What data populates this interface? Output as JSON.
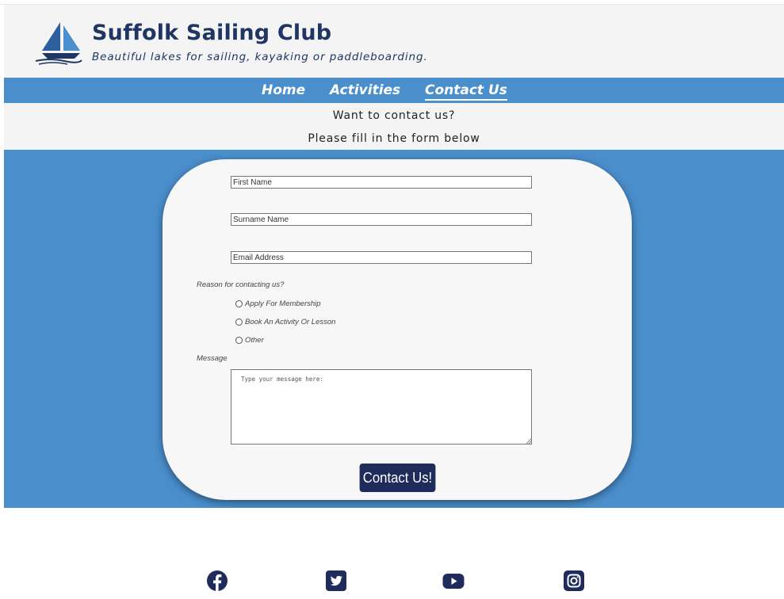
{
  "header": {
    "title": "Suffolk Sailing Club",
    "tagline": "Beautiful lakes for sailing, kayaking or paddleboarding.",
    "logo_icon": "sailboat-icon"
  },
  "nav": {
    "items": [
      {
        "label": "Home",
        "active": false
      },
      {
        "label": "Activities",
        "active": false
      },
      {
        "label": "Contact Us",
        "active": true
      }
    ]
  },
  "intro": {
    "line1": "Want to contact us?",
    "line2": "Please fill in the form below"
  },
  "form": {
    "first_name_placeholder": "First Name",
    "surname_placeholder": "Surname Name",
    "email_placeholder": "Email Address",
    "reason_label": "Reason for contacting us?",
    "reasons": [
      "Apply For Membership",
      "Book An Activity Or Lesson",
      "Other"
    ],
    "message_label": "Message",
    "message_placeholder": "Type your message here:",
    "submit_label": "Contact Us!"
  },
  "footer": {
    "social_icons": [
      "facebook-icon",
      "twitter-icon",
      "youtube-icon",
      "instagram-icon"
    ]
  },
  "colors": {
    "brand_navy": "#1f3564",
    "band_blue": "#4a8ecc",
    "button_navy": "#1f2b5a",
    "panel_grey": "#f4f4f4"
  }
}
